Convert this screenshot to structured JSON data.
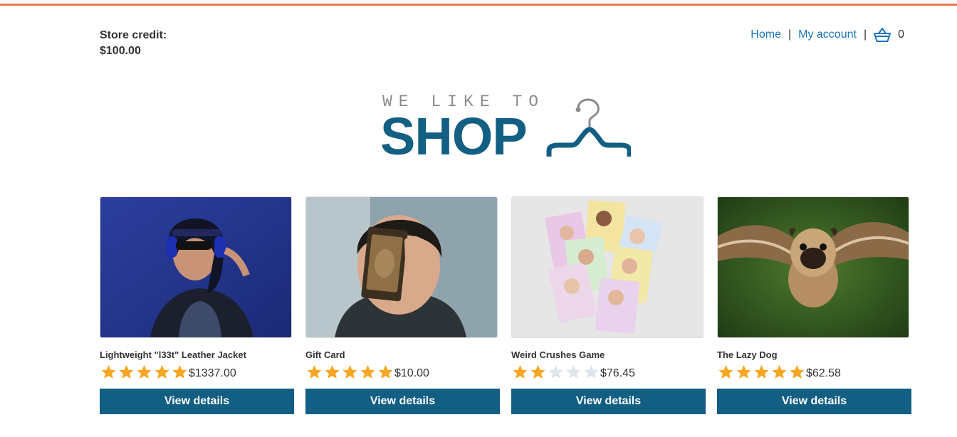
{
  "header": {
    "credit_label": "Store credit:",
    "credit_value": "$100.00",
    "nav": {
      "home": "Home",
      "separator": "|",
      "my_account": "My account",
      "cart_icon": "basket-icon",
      "cart_count": "0"
    }
  },
  "logo": {
    "top_text": "WE LIKE TO",
    "main_text": "SHOP",
    "icon": "hanger-icon"
  },
  "products": [
    {
      "name": "Lightweight \"l33t\" Leather Jacket",
      "rating": 5,
      "price": "$1337.00",
      "button": "View details"
    },
    {
      "name": "Gift Card",
      "rating": 5,
      "price": "$10.00",
      "button": "View details"
    },
    {
      "name": "Weird Crushes Game",
      "rating": 2,
      "price": "$76.45",
      "button": "View details"
    },
    {
      "name": "The Lazy Dog",
      "rating": 5,
      "price": "$62.58",
      "button": "View details"
    }
  ],
  "colors": {
    "accent_border": "#e9774b",
    "brand_blue": "#135e83",
    "link_blue": "#1a73b8",
    "star_filled": "#f5a623",
    "star_empty": "#dfe6ea"
  }
}
